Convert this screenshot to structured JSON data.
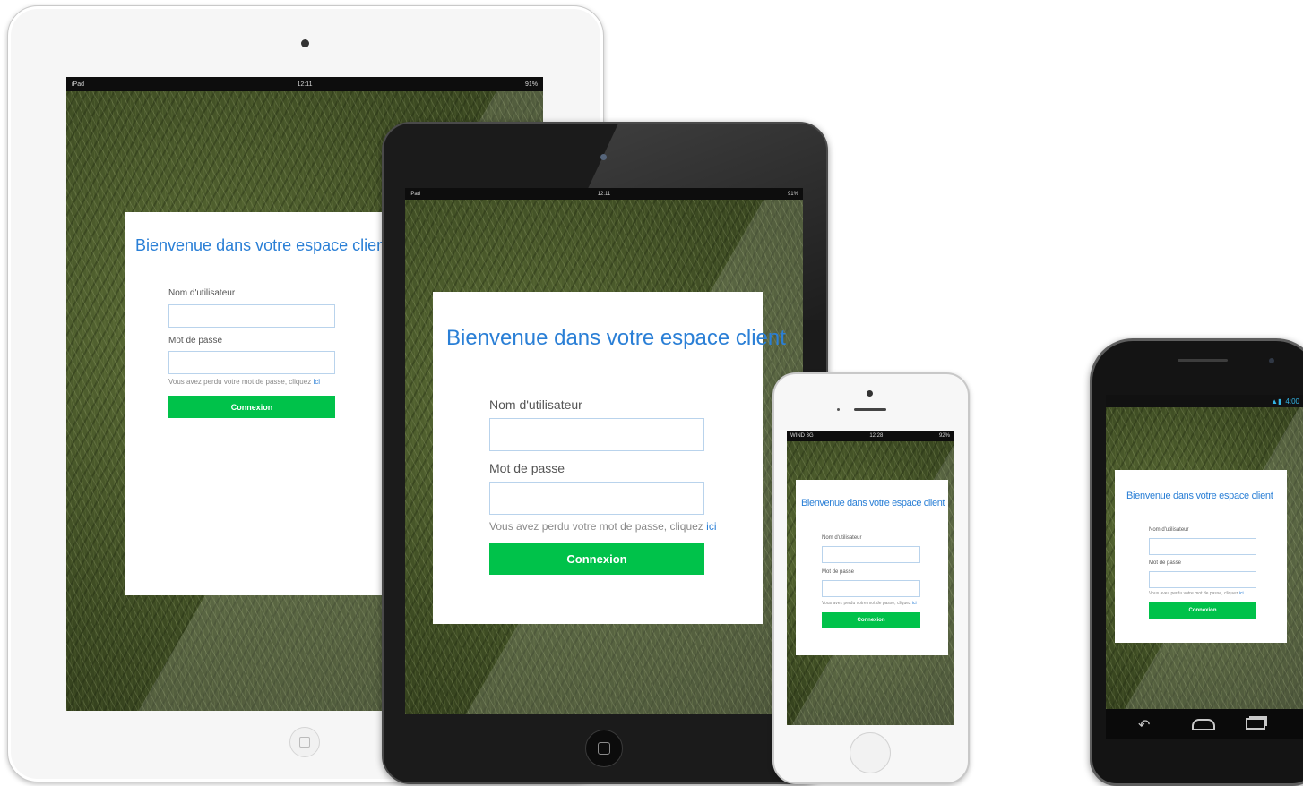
{
  "login": {
    "title": "Bienvenue dans votre espace client",
    "username_label": "Nom d'utilisateur",
    "password_label": "Mot de passe",
    "forgot_text": "Vous avez perdu votre mot de passe, cliquez",
    "forgot_link": "ici",
    "submit_label": "Connexion"
  },
  "ipad_status": {
    "carrier": "iPad",
    "time": "12:11",
    "battery": "91%"
  },
  "iphone_status": {
    "carrier": "WIND 3G",
    "time": "12:28",
    "battery": "92%"
  },
  "android_status": {
    "time": "4:00"
  },
  "colors": {
    "title_blue": "#2a7fd6",
    "button_green": "#00c24a"
  }
}
